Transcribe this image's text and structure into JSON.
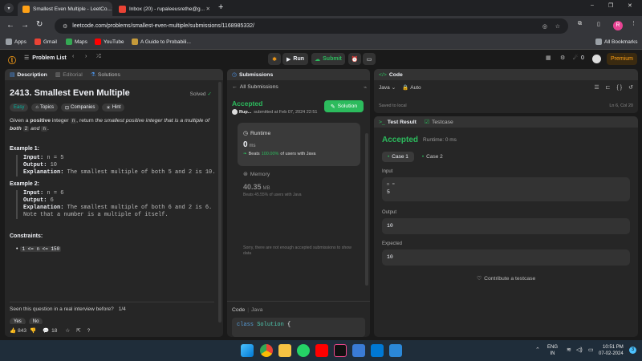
{
  "browser": {
    "tabs": [
      {
        "title": "Smallest Even Multiple - LeetCo..."
      },
      {
        "title": "Inbox (20) - rupaleeusrethe@g..."
      }
    ],
    "new_tab": "+",
    "url": "leetcode.com/problems/smallest-even-multiple/submissions/1168985332/",
    "bookmarks": [
      "Apps",
      "Gmail",
      "Maps",
      "YouTube",
      "A Guide to Probabili..."
    ],
    "all_bookmarks": "All Bookmarks",
    "profile_initial": "R"
  },
  "nav": {
    "problem_list": "Problem List",
    "run": "Run",
    "submit": "Submit",
    "streak": "0",
    "premium": "Premium"
  },
  "description": {
    "tabs": [
      "Description",
      "Editorial",
      "Solutions"
    ],
    "title": "2413. Smallest Even Multiple",
    "status": "Solved",
    "tags": [
      "Easy",
      "Topics",
      "Companies",
      "Hint"
    ],
    "statement": {
      "p1": "Given a ",
      "p2": "positive",
      "p3": " integer ",
      "n": "n",
      "p4": ", return ",
      "p5": "the smallest positive integer that is a multiple of ",
      "p6": "both",
      "two": "2",
      "p7": " and ",
      "p8": "."
    },
    "examples": [
      {
        "heading": "Example 1:",
        "input_label": "Input:",
        "input": " n = 5",
        "output_label": "Output:",
        "output": " 10",
        "exp_label": "Explanation:",
        "exp": " The smallest multiple of both 5 and 2 is 10."
      },
      {
        "heading": "Example 2:",
        "input_label": "Input:",
        "input": " n = 6",
        "output_label": "Output:",
        "output": " 6",
        "exp_label": "Explanation:",
        "exp": " The smallest multiple of both 6 and 2 is 6. Note that a number is a multiple of itself."
      }
    ],
    "constraints_heading": "Constraints:",
    "constraint": "1 <= n <= 150",
    "interview_q": "Seen this question in a real interview before?",
    "interview_count": "1/4",
    "yes": "Yes",
    "no": "No",
    "likes": "843",
    "comments": "18"
  },
  "submissions": {
    "tab": "Submissions",
    "back": "All Submissions",
    "status": "Accepted",
    "user": "Rup...",
    "submitted": "submitted at Feb 07, 2024 22:51",
    "solution_btn": "Solution",
    "runtime_label": "Runtime",
    "runtime_value": "0",
    "runtime_unit": "ms",
    "beats_prefix": "Beats",
    "beats_pct": "100.00%",
    "beats_suffix": "of users with Java",
    "memory_label": "Memory",
    "memory_value": "40.35",
    "memory_unit": "MB",
    "mem_beats": "Beats 45.55% of users with Java",
    "sorry": "Sorry, there are not enough accepted submissions to show data",
    "code_label": "Code",
    "lang": "Java",
    "code_line_kw": "class",
    "code_line_name": "Solution",
    "code_line_brace": "{"
  },
  "code_panel": {
    "tab": "Code",
    "lang": "Java",
    "auto": "Auto",
    "saved": "Saved to local",
    "pos": "Ln 6, Col 20"
  },
  "testresult": {
    "tab1": "Test Result",
    "tab2": "Testcase",
    "status": "Accepted",
    "runtime": "Runtime: 0 ms",
    "cases": [
      "Case 1",
      "Case 2"
    ],
    "input_label": "Input",
    "input_var": "n =",
    "input_val": "5",
    "output_label": "Output",
    "output_val": "10",
    "expected_label": "Expected",
    "expected_val": "10",
    "contribute": "Contribute a testcase"
  },
  "taskbar": {
    "lang1": "ENG",
    "lang2": "IN",
    "time": "10:51 PM",
    "date": "07-02-2024",
    "notif": "3"
  },
  "colors": {
    "accent": "#2cbb5d",
    "orange": "#ffa116",
    "easy": "#00b8a3"
  }
}
